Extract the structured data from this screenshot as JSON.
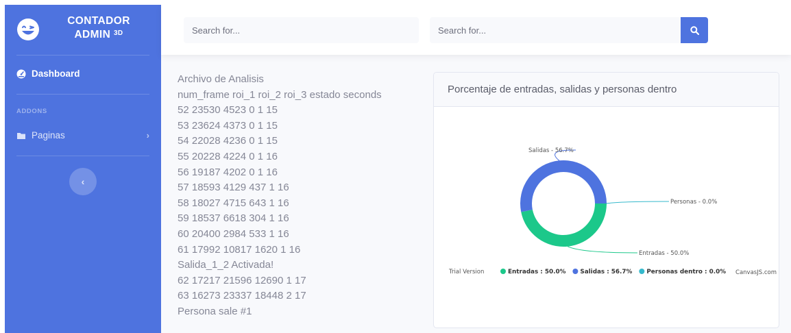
{
  "sidebar": {
    "brand_line1": "CONTADOR",
    "brand_line2": "ADMIN",
    "brand_sup": "3D",
    "dashboard_label": "Dashboard",
    "heading": "ADDONS",
    "paginas_label": "Paginas",
    "toggle_glyph": "‹",
    "paginas_chevron": "›"
  },
  "topbar": {
    "search1_placeholder": "Search for...",
    "search2_placeholder": "Search for..."
  },
  "log": {
    "lines": [
      "Archivo de Analisis",
      "num_frame roi_1 roi_2 roi_3 estado seconds",
      "52 23530 4523 0 1 15",
      "53 23624 4373 0 1 15",
      "54 22028 4236 0 1 15",
      "55 20228 4224 0 1 16",
      "56 19187 4202 0 1 16",
      "57 18593 4129 437 1 16",
      "58 18027 4715 643 1 16",
      "59 18537 6618 304 1 16",
      "60 20400 2984 533 1 16",
      "61 17992 10817 1620 1 16",
      "Salida_1_2 Activada!",
      "62 17217 21596 12690 1 17",
      "63 16273 23337 18448 2 17",
      "Persona sale #1"
    ]
  },
  "card": {
    "title": "Porcentaje de entradas, salidas y personas dentro"
  },
  "chart_data": {
    "type": "pie",
    "title": "",
    "categories": [
      "Entradas",
      "Salidas",
      "Personas dentro"
    ],
    "values": [
      50.0,
      56.7,
      0.0
    ],
    "index_labels": [
      "Entradas - 50.0%",
      "Salidas - 56.7%",
      "Personas - 0.0%"
    ],
    "legend_labels": [
      "Entradas : 50.0%",
      "Salidas : 56.7%",
      "Personas dentro : 0.0%"
    ],
    "colors": [
      "#1cc88a",
      "#4e73df",
      "#36b9cc"
    ],
    "legend_position": "bottom",
    "trial_text": "Trial Version",
    "credit_text": "CanvasJS.com"
  },
  "colors": {
    "primary": "#4e73df",
    "success": "#1cc88a",
    "info": "#36b9cc"
  },
  "icons": {
    "brand": "laugh-wink-icon",
    "dashboard": "tachometer-icon",
    "paginas": "folder-icon",
    "search": "search-icon"
  }
}
